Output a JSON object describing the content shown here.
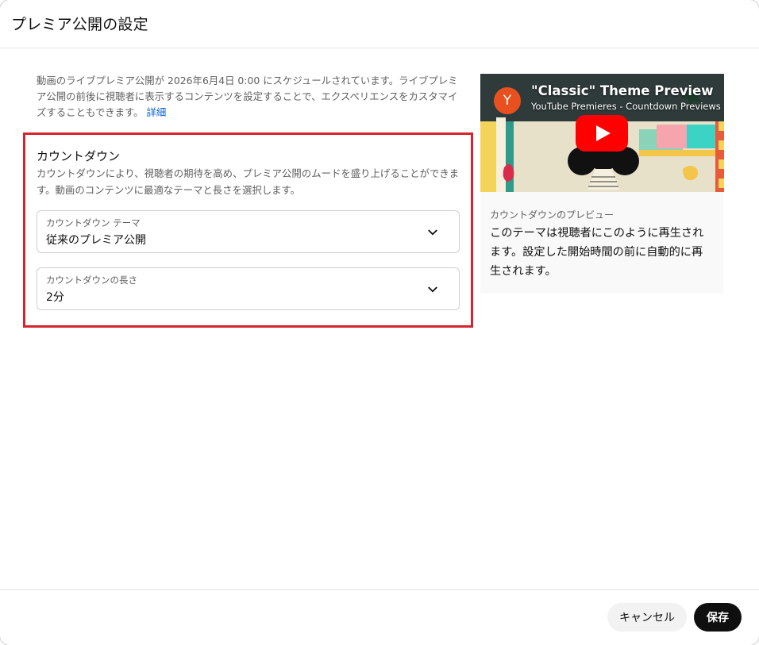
{
  "dialog": {
    "title": "プレミア公開の設定"
  },
  "intro": {
    "text": "動画のライブプレミア公開が 2026年6月4日 0:00 にスケジュールされています。ライブプレミア公開の前後に視聴者に表示するコンテンツを設定することで、エクスペリエンスをカスタマイズすることもできます。",
    "link": "詳細"
  },
  "countdown": {
    "title": "カウントダウン",
    "description": "カウントダウンにより、視聴者の期待を高め、プレミア公開のムードを盛り上げることができます。動画のコンテンツに最適なテーマと長さを選択します。",
    "theme": {
      "label": "カウントダウン テーマ",
      "value": "従来のプレミア公開"
    },
    "length": {
      "label": "カウントダウンの長さ",
      "value": "2分"
    }
  },
  "video": {
    "avatar_letter": "Y",
    "title": "\"Classic\" Theme Preview",
    "channel": "YouTube Premieres - Countdown Previews",
    "play_icon": "play-icon"
  },
  "preview": {
    "label": "カウントダウンのプレビュー",
    "description": "このテーマは視聴者にこのように再生されます。設定した開始時間の前に自動的に再生されます。"
  },
  "footer": {
    "cancel_label": "キャンセル",
    "save_label": "保存"
  },
  "colors": {
    "highlight_border": "#d6232c",
    "link": "#065fd4",
    "primary_button": "#0f0f0f",
    "play_button": "#ff0000"
  }
}
